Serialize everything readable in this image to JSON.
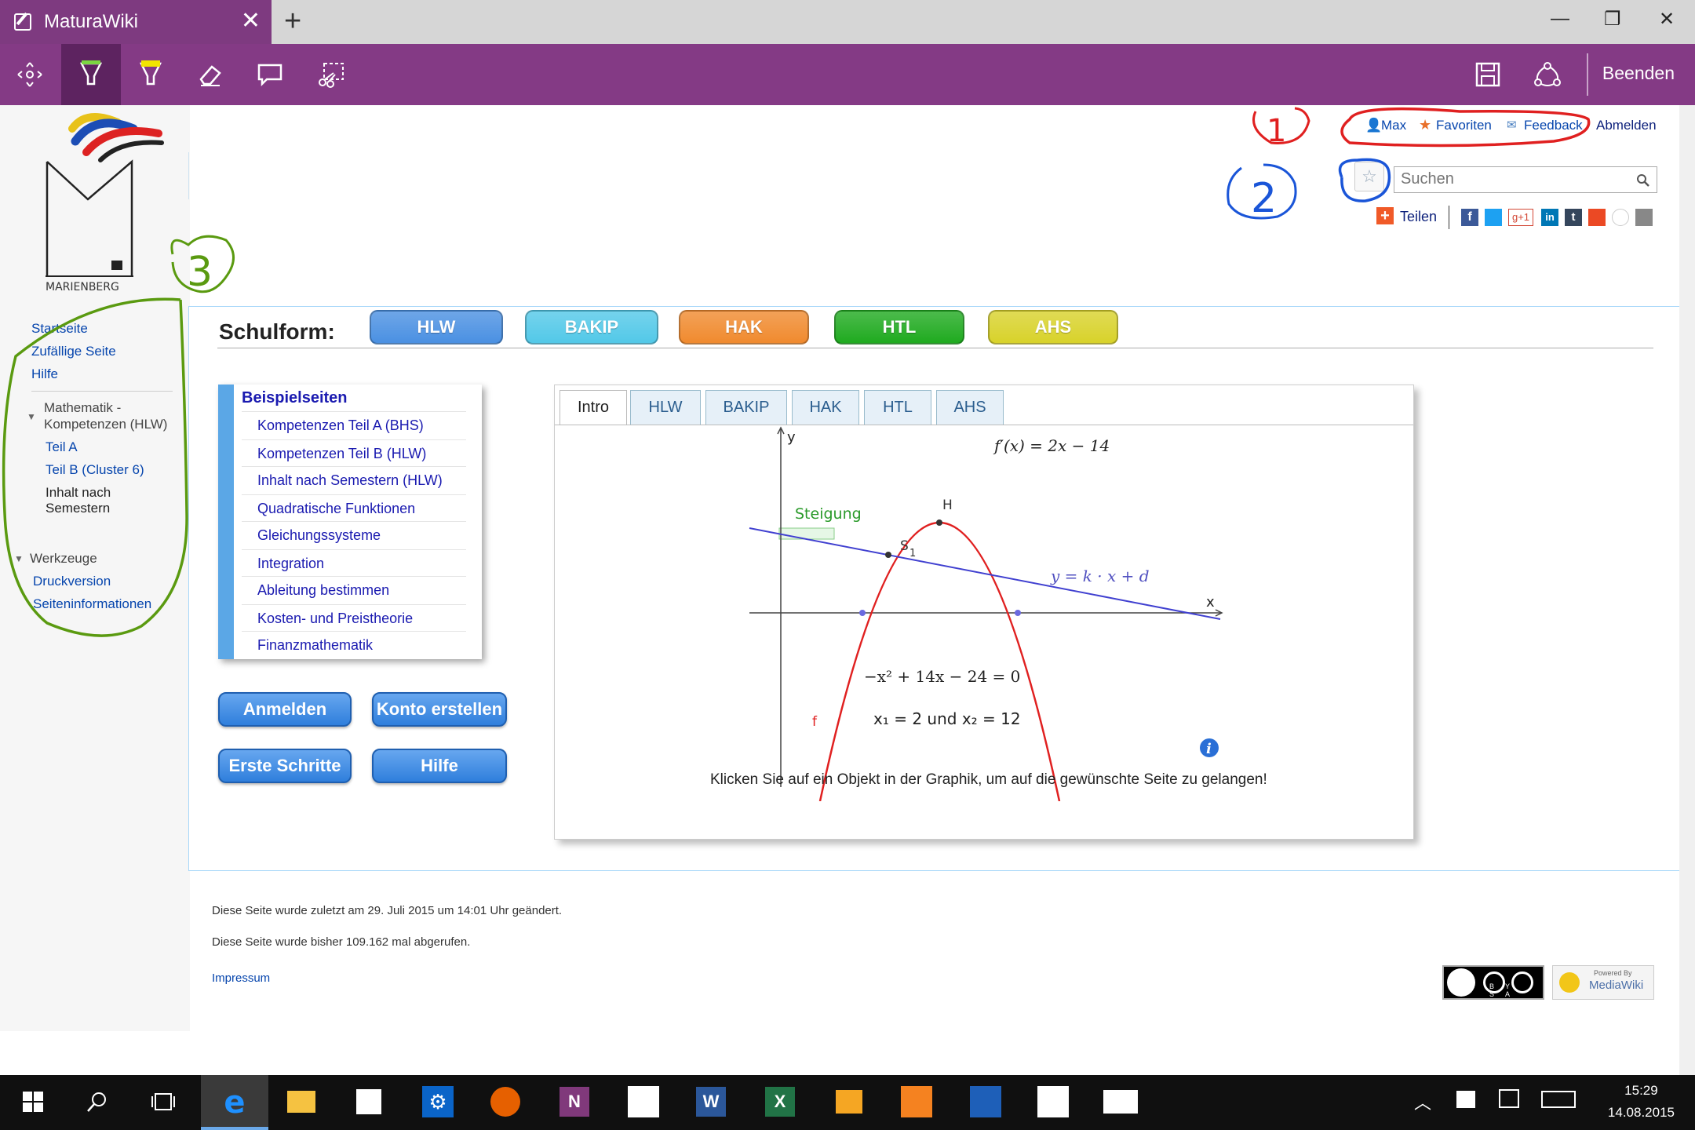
{
  "browser": {
    "tab_title": "MaturaWiki",
    "tab_close": "✕",
    "new_tab": "+",
    "minimize": "—",
    "restore": "❐",
    "close": "✕"
  },
  "toolbar": {
    "beenden_label": "Beenden",
    "icons": [
      "pan-icon",
      "pen-icon",
      "highlighter-icon",
      "eraser-icon",
      "comment-icon",
      "clip-icon",
      "save-icon",
      "share-icon"
    ]
  },
  "personal": {
    "user": "Max",
    "favorites": "Favoriten",
    "feedback": "Feedback",
    "logout": "Abmelden"
  },
  "search": {
    "placeholder": "Suchen"
  },
  "share": {
    "label": "Teilen"
  },
  "logo": {
    "text": "MARIENBERG"
  },
  "annotations": {
    "a1": "1",
    "a2": "2",
    "a3": "3"
  },
  "sidebar": {
    "links": [
      "Startseite",
      "Zufällige Seite",
      "Hilfe"
    ],
    "section1": "Mathematik -\nKompetenzen (HLW)",
    "section1_line1": "Mathematik -",
    "section1_line2": "Kompetenzen (HLW)",
    "section1_items": [
      "Teil A",
      "Teil B (Cluster 6)",
      "Inhalt nach",
      "Semestern"
    ],
    "tools_title": "Werkzeuge",
    "tools": [
      "Druckversion",
      "Seiteninformationen"
    ]
  },
  "schulform": {
    "label": "Schulform:",
    "buttons": [
      {
        "label": "HLW",
        "color": "#4a90e2"
      },
      {
        "label": "BAKIP",
        "color": "#52c8e8"
      },
      {
        "label": "HAK",
        "color": "#f08a2e"
      },
      {
        "label": "HTL",
        "color": "#1faa1f"
      },
      {
        "label": "AHS",
        "color": "#d8d22a"
      }
    ]
  },
  "beispielseiten": {
    "title": "Beispielseiten",
    "items": [
      "Kompetenzen Teil A (BHS)",
      "Kompetenzen Teil B (HLW)",
      "Inhalt nach Semestern (HLW)",
      "Quadratische Funktionen",
      "Gleichungssysteme",
      "Integration",
      "Ableitung bestimmen",
      "Kosten- und Preistheorie",
      "Finanzmathematik"
    ]
  },
  "actions": {
    "login": "Anmelden",
    "create_account": "Konto erstellen",
    "first_steps": "Erste Schritte",
    "help": "Hilfe"
  },
  "graph": {
    "tabs": [
      "Intro",
      "HLW",
      "BAKIP",
      "HAK",
      "HTL",
      "AHS"
    ],
    "y_axis": "y",
    "x_axis": "x",
    "derivative": "f′(x) = 2x − 14",
    "steigung": "Steigung",
    "h_label": "H",
    "s_label": "S",
    "s_sub": "1",
    "line_label": "y = k · x + d",
    "equation": "−x² + 14x − 24 = 0",
    "solution": "x₁ = 2 und x₂ = 12",
    "f_label": "f",
    "info_glyph": "i",
    "caption": "Klicken Sie auf ein Objekt in der Graphik, um auf die gewünschte Seite zu gelangen!"
  },
  "footer": {
    "last_modified": "Diese Seite wurde zuletzt am 29. Juli 2015 um 14:01 Uhr geändert.",
    "views": "Diese Seite wurde bisher 109.162 mal abgerufen.",
    "impressum": "Impressum",
    "cc_text": "BY SA",
    "mw_text1": "Powered By",
    "mw_text2": "MediaWiki"
  },
  "taskbar": {
    "time": "15:29",
    "date": "14.08.2015"
  }
}
